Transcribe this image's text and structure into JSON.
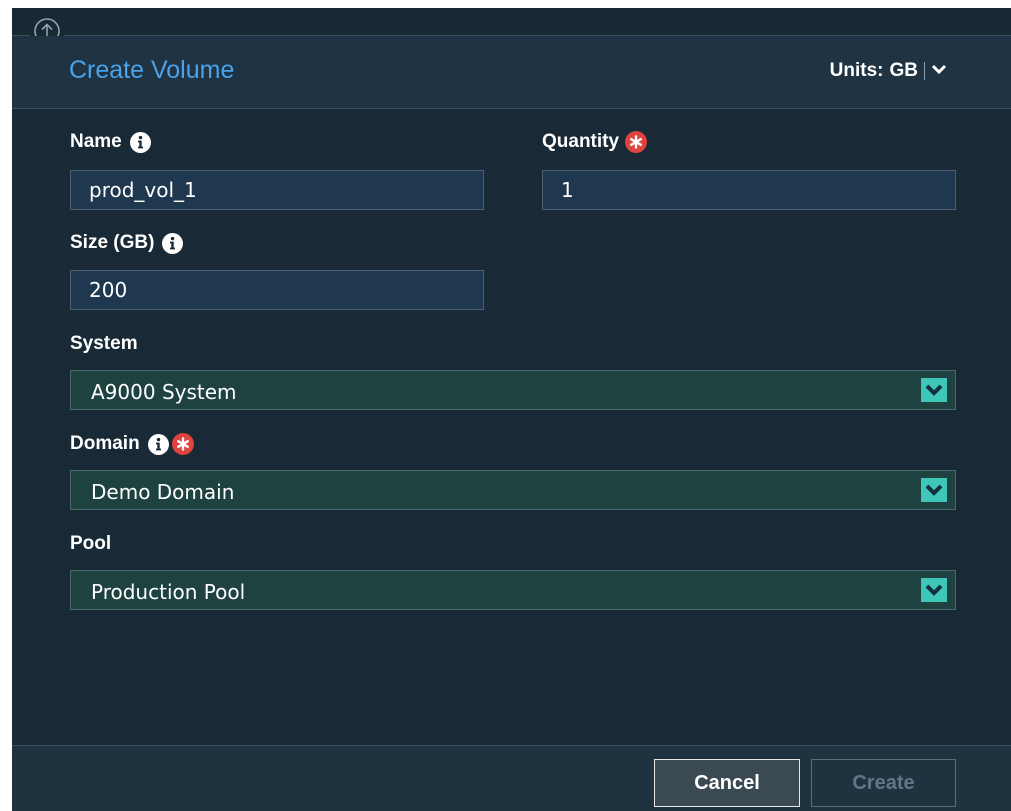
{
  "dialog": {
    "title": "Create Volume",
    "units": {
      "label": "Units:",
      "value": "GB"
    }
  },
  "form": {
    "name": {
      "label": "Name",
      "value": "prod_vol_1"
    },
    "quantity": {
      "label": "Quantity",
      "value": "1"
    },
    "size": {
      "label": "Size (GB)",
      "value": "200"
    },
    "system": {
      "label": "System",
      "value": "A9000 System"
    },
    "domain": {
      "label": "Domain",
      "value": "Demo Domain"
    },
    "pool": {
      "label": "Pool",
      "value": "Production Pool"
    }
  },
  "footer": {
    "cancel_label": "Cancel",
    "create_label": "Create"
  },
  "icons": {
    "collapse": "arrow-up-circle-icon",
    "info": "info-icon",
    "required": "required-asterisk-icon",
    "dropdown": "chevron-down-icon"
  },
  "colors": {
    "title": "#4aa3ea",
    "background": "#192a36",
    "input_bg": "#1f3850",
    "select_bg": "#1d4240",
    "dropdown_accent": "#3ec7b8",
    "required": "#e0443e"
  }
}
